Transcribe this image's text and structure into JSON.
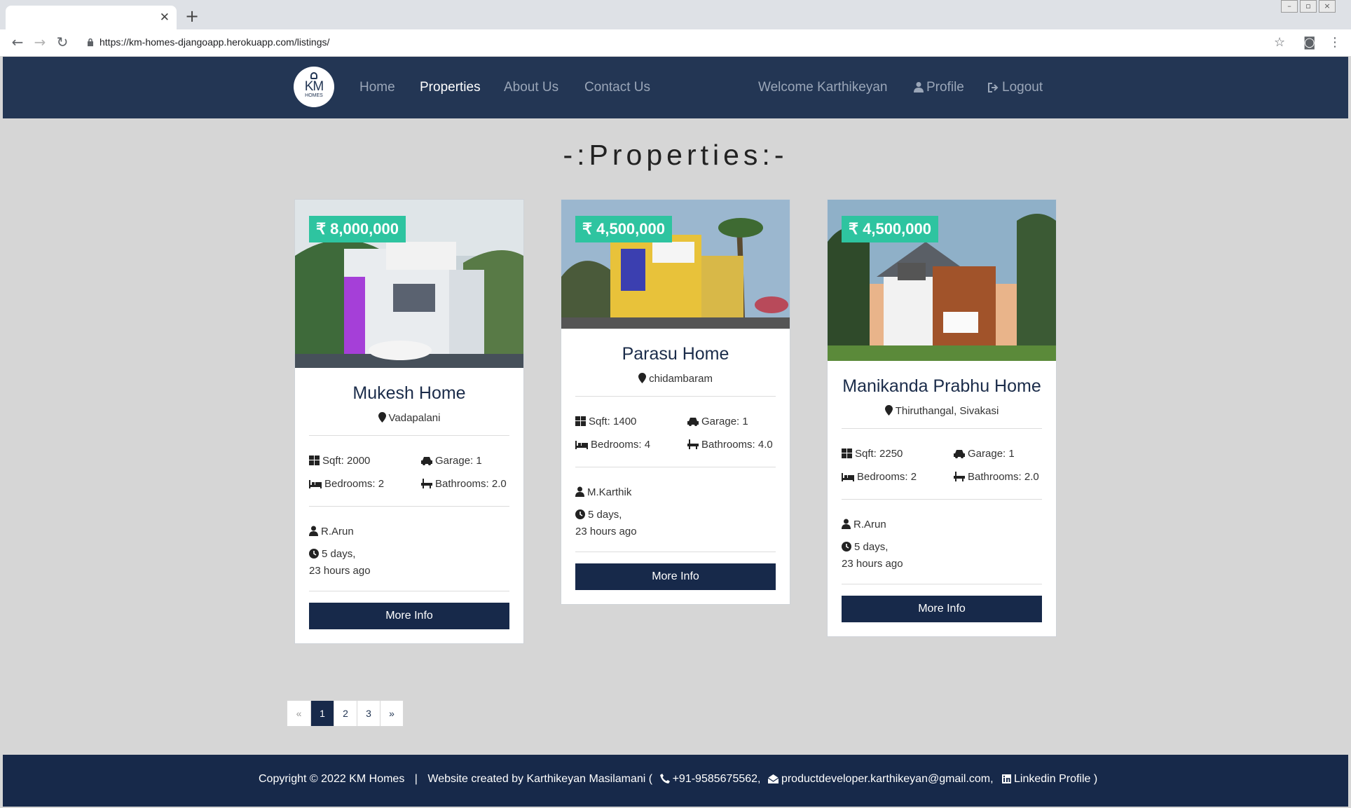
{
  "browser": {
    "url": "https://km-homes-djangoapp.herokuapp.com/listings/",
    "new_tab_glyph": "+",
    "close_tab_glyph": "✕"
  },
  "nav": {
    "logo_text": "KM",
    "logo_sub": "HOMES",
    "home": "Home",
    "properties": "Properties",
    "about": "About Us",
    "contact": "Contact Us",
    "welcome": "Welcome Karthikeyan",
    "profile": "Profile",
    "logout": "Logout"
  },
  "page": {
    "heading": "-:Properties:-"
  },
  "listings": [
    {
      "price": "₹ 8,000,000",
      "title": "Mukesh Home",
      "location": "Vadapalani",
      "sqft": "Sqft: 2000",
      "garage": "Garage: 1",
      "bedrooms": "Bedrooms: 2",
      "bathrooms": "Bathrooms: 2.0",
      "realtor": "R.Arun",
      "time_1": "5 days,",
      "time_2": "23 hours ago",
      "button": "More Info"
    },
    {
      "price": "₹ 4,500,000",
      "title": "Parasu Home",
      "location": "chidambaram",
      "sqft": "Sqft: 1400",
      "garage": "Garage: 1",
      "bedrooms": "Bedrooms: 4",
      "bathrooms": "Bathrooms: 4.0",
      "realtor": "M.Karthik",
      "time_1": "5 days,",
      "time_2": "23 hours ago",
      "button": "More Info"
    },
    {
      "price": "₹ 4,500,000",
      "title": "Manikanda Prabhu Home",
      "location": "Thiruthangal, Sivakasi",
      "sqft": "Sqft: 2250",
      "garage": "Garage: 1",
      "bedrooms": "Bedrooms: 2",
      "bathrooms": "Bathrooms: 2.0",
      "realtor": "R.Arun",
      "time_1": "5 days,",
      "time_2": "23 hours ago",
      "button": "More Info"
    }
  ],
  "pagination": {
    "prev": "«",
    "pages": [
      "1",
      "2",
      "3"
    ],
    "next": "»",
    "current": "1"
  },
  "footer": {
    "copyright": "Copyright © 2022 KM Homes",
    "separator": "|",
    "created_by": "Website created by Karthikeyan Masilamani (",
    "phone": "+91-9585675562,",
    "email": "productdeveloper.karthikeyan@gmail.com,",
    "linkedin": "Linkedin Profile )"
  },
  "colors": {
    "navbar": "#233654",
    "button": "#17294a",
    "price_badge": "#2ec4a0",
    "page_background": "#d6d6d6"
  }
}
